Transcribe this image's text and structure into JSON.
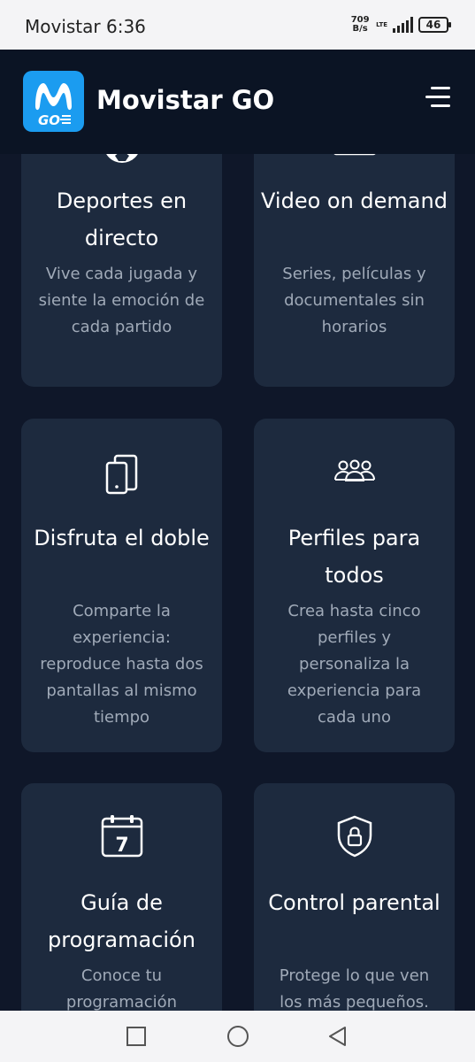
{
  "status_bar": {
    "carrier": "Movistar",
    "time": "6:36",
    "speed_value": "709",
    "speed_unit": "B/s",
    "network": "LTE",
    "battery": "46"
  },
  "header": {
    "logo_text": "GO",
    "title": "Movistar GO",
    "menu_icon": "hamburger-menu-icon"
  },
  "cards": [
    {
      "icon": "soccer-ball-icon",
      "title": "Deportes en directo",
      "description": "Vive cada jugada y siente la emoción de cada partido"
    },
    {
      "icon": "video-player-icon",
      "title": "Video on demand",
      "description": "Series, películas y documentales sin horarios"
    },
    {
      "icon": "dual-screen-icon",
      "title": "Disfruta el doble",
      "description": "Comparte la experiencia: reproduce hasta dos pantallas al mismo tiempo"
    },
    {
      "icon": "group-people-icon",
      "title": "Perfiles para todos",
      "description": "Crea hasta cinco perfiles y personaliza la experiencia para cada uno"
    },
    {
      "icon": "calendar-icon",
      "calendar_day": "7",
      "title": "Guía de programación",
      "description": "Conoce tu programación"
    },
    {
      "icon": "shield-lock-icon",
      "title": "Control parental",
      "description": "Protege lo que ven los más pequeños."
    }
  ],
  "nav_bar": {
    "recents_icon": "square-recents-icon",
    "home_icon": "circle-home-icon",
    "back_icon": "triangle-back-icon"
  },
  "colors": {
    "background": "#0f1729",
    "header": "#0b1424",
    "card": "#1d2a3e",
    "brand_blue": "#1b9cf0",
    "description_text": "#a0aab8"
  }
}
